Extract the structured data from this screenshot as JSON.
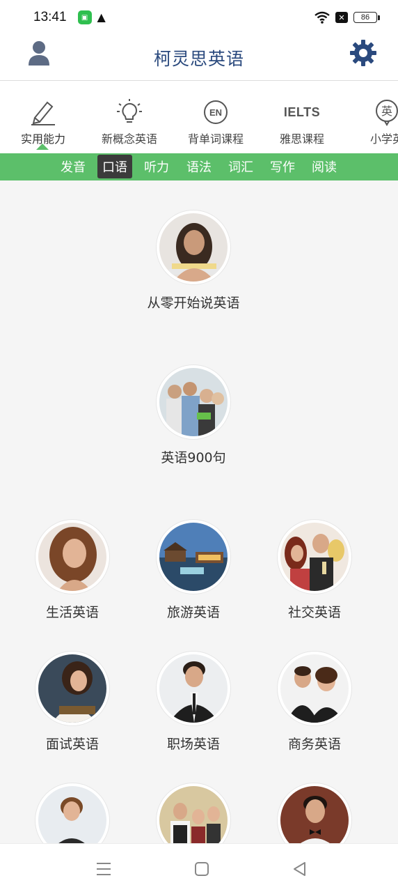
{
  "status_bar": {
    "time": "13:41",
    "battery": "86",
    "icons": [
      "app-badge-icon",
      "warning-icon",
      "wifi-icon",
      "notification-x-icon",
      "battery-icon"
    ]
  },
  "header": {
    "title": "柯灵思英语",
    "left_icon": "profile-icon",
    "right_icon": "gear-icon"
  },
  "categories": [
    {
      "label": "实用能力",
      "icon": "pencil-icon",
      "active": true
    },
    {
      "label": "新概念英语",
      "icon": "lightbulb-icon",
      "active": false
    },
    {
      "label": "背单词课程",
      "icon": "en-circle-icon",
      "icon_text": "EN",
      "active": false
    },
    {
      "label": "雅思课程",
      "icon": "ielts-icon",
      "icon_text": "IELTS",
      "active": false
    },
    {
      "label": "小学英",
      "icon": "ying-badge-icon",
      "icon_text": "英",
      "active": false
    }
  ],
  "sub_tabs": [
    {
      "label": "发音",
      "active": false
    },
    {
      "label": "口语",
      "active": true
    },
    {
      "label": "听力",
      "active": false
    },
    {
      "label": "语法",
      "active": false
    },
    {
      "label": "词汇",
      "active": false
    },
    {
      "label": "写作",
      "active": false
    },
    {
      "label": "阅读",
      "active": false
    }
  ],
  "courses": [
    {
      "label": "从零开始说英语"
    },
    {
      "label": "英语900句"
    },
    {
      "label": "生活英语"
    },
    {
      "label": "旅游英语"
    },
    {
      "label": "社交英语"
    },
    {
      "label": "面试英语"
    },
    {
      "label": "职场英语"
    },
    {
      "label": "商务英语"
    },
    {
      "label": ""
    },
    {
      "label": ""
    },
    {
      "label": ""
    }
  ],
  "nav": {
    "icons": [
      "menu-icon",
      "home-square-icon",
      "back-triangle-icon"
    ]
  },
  "colors": {
    "accent_green": "#5cbf6a",
    "title_blue": "#2b4a7e",
    "active_subtab": "#3b3b3b"
  }
}
